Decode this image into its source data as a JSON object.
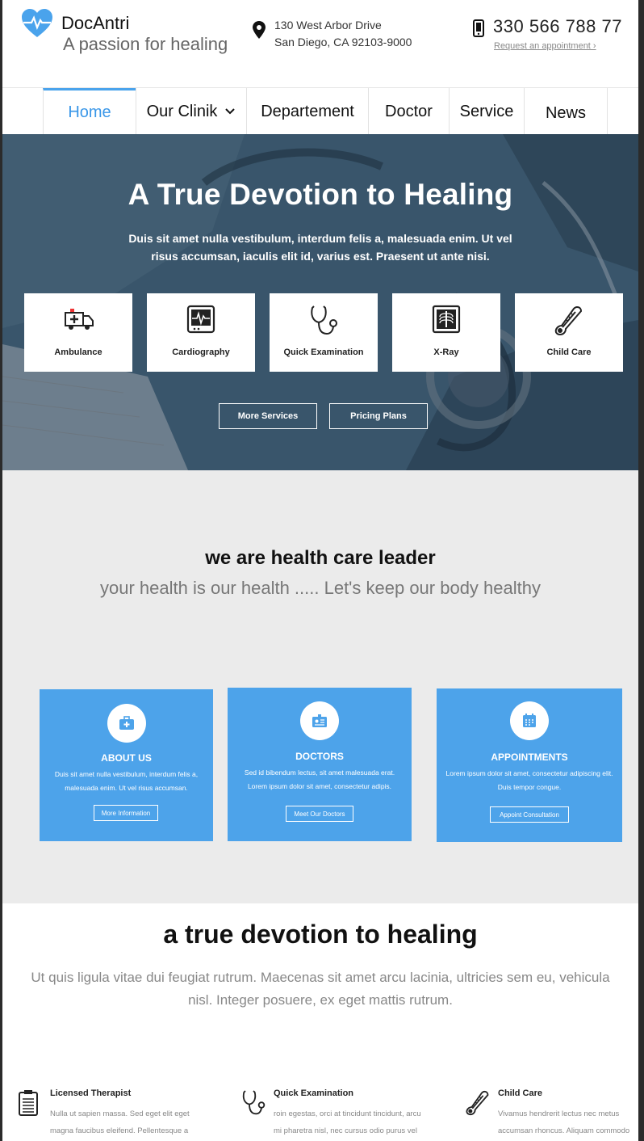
{
  "header": {
    "brand": "DocAntri",
    "tagline": "A passion for healing",
    "address_line1": "130 West Arbor Drive",
    "address_line2": "San Diego, CA 92103-9000",
    "phone": "330 566 788 77",
    "request_link": "Request an appointment ›"
  },
  "nav": {
    "items": [
      {
        "label": "Home",
        "active": true
      },
      {
        "label": "Our Clinik",
        "has_dropdown": true
      },
      {
        "label": "Departement"
      },
      {
        "label": "Doctor"
      },
      {
        "label": "Service"
      },
      {
        "label": "News"
      }
    ]
  },
  "hero": {
    "title": "A True Devotion to Healing",
    "subtitle": "Duis sit amet nulla vestibulum, interdum felis a, malesuada enim. Ut vel risus accumsan, iaculis elit id, varius est. Praesent ut ante nisi.",
    "services": [
      {
        "label": "Ambulance",
        "icon": "ambulance-icon"
      },
      {
        "label": "Cardiography",
        "icon": "cardiograph-icon"
      },
      {
        "label": "Quick Examination",
        "icon": "stethoscope-icon"
      },
      {
        "label": "X-Ray",
        "icon": "xray-icon"
      },
      {
        "label": "Child Care",
        "icon": "thermometer-icon"
      }
    ],
    "buttons": {
      "more_services": "More Services",
      "pricing_plans": "Pricing Plans"
    }
  },
  "leader": {
    "heading": "we are  health care leader",
    "subheading": "your health is our health ..... Let's keep our body healthy",
    "cards": [
      {
        "title": "ABOUT US",
        "icon": "medkit-icon",
        "text": "Duis sit amet nulla vestibulum, interdum felis a, malesuada enim. Ut vel risus accumsan.",
        "button": "More Information"
      },
      {
        "title": "DOCTORS",
        "icon": "id-card-icon",
        "text": "Sed id bibendum lectus, sit amet malesuada erat. Lorem ipsum dolor sit amet, consectetur adipis.",
        "button": "Meet Our Doctors"
      },
      {
        "title": "APPOINTMENTS",
        "icon": "calendar-icon",
        "text": "Lorem ipsum dolor sit amet, consectetur adipiscing elit. Duis tempor congue.",
        "button": "Appoint Consultation"
      }
    ]
  },
  "devotion": {
    "heading": "a true devotion to healing",
    "text": "Ut quis ligula vitae dui feugiat rutrum. Maecenas sit amet arcu lacinia, ultricies sem eu, vehicula nisl. Integer posuere, ex eget mattis rutrum.",
    "features": [
      {
        "title": "Licensed Therapist",
        "icon": "clipboard-icon",
        "line1": "Nulla ut sapien massa. Sed eget elit eget",
        "line2": "magna faucibus eleifend. Pellentesque a"
      },
      {
        "title": "Quick Examination",
        "icon": "stethoscope-icon",
        "line1": "roin egestas, orci at tincidunt tincidunt, arcu",
        "line2": "mi pharetra nisl, nec cursus odio purus vel"
      },
      {
        "title": "Child Care",
        "icon": "thermometer-icon",
        "line1": "Vivamus hendrerit lectus nec metus",
        "line2": "accumsan rhoncus. Aliquam commodo"
      }
    ]
  },
  "colors": {
    "accent": "#4da3ea",
    "nav_active": "#3a97e8",
    "section_gray": "#ebebeb"
  }
}
